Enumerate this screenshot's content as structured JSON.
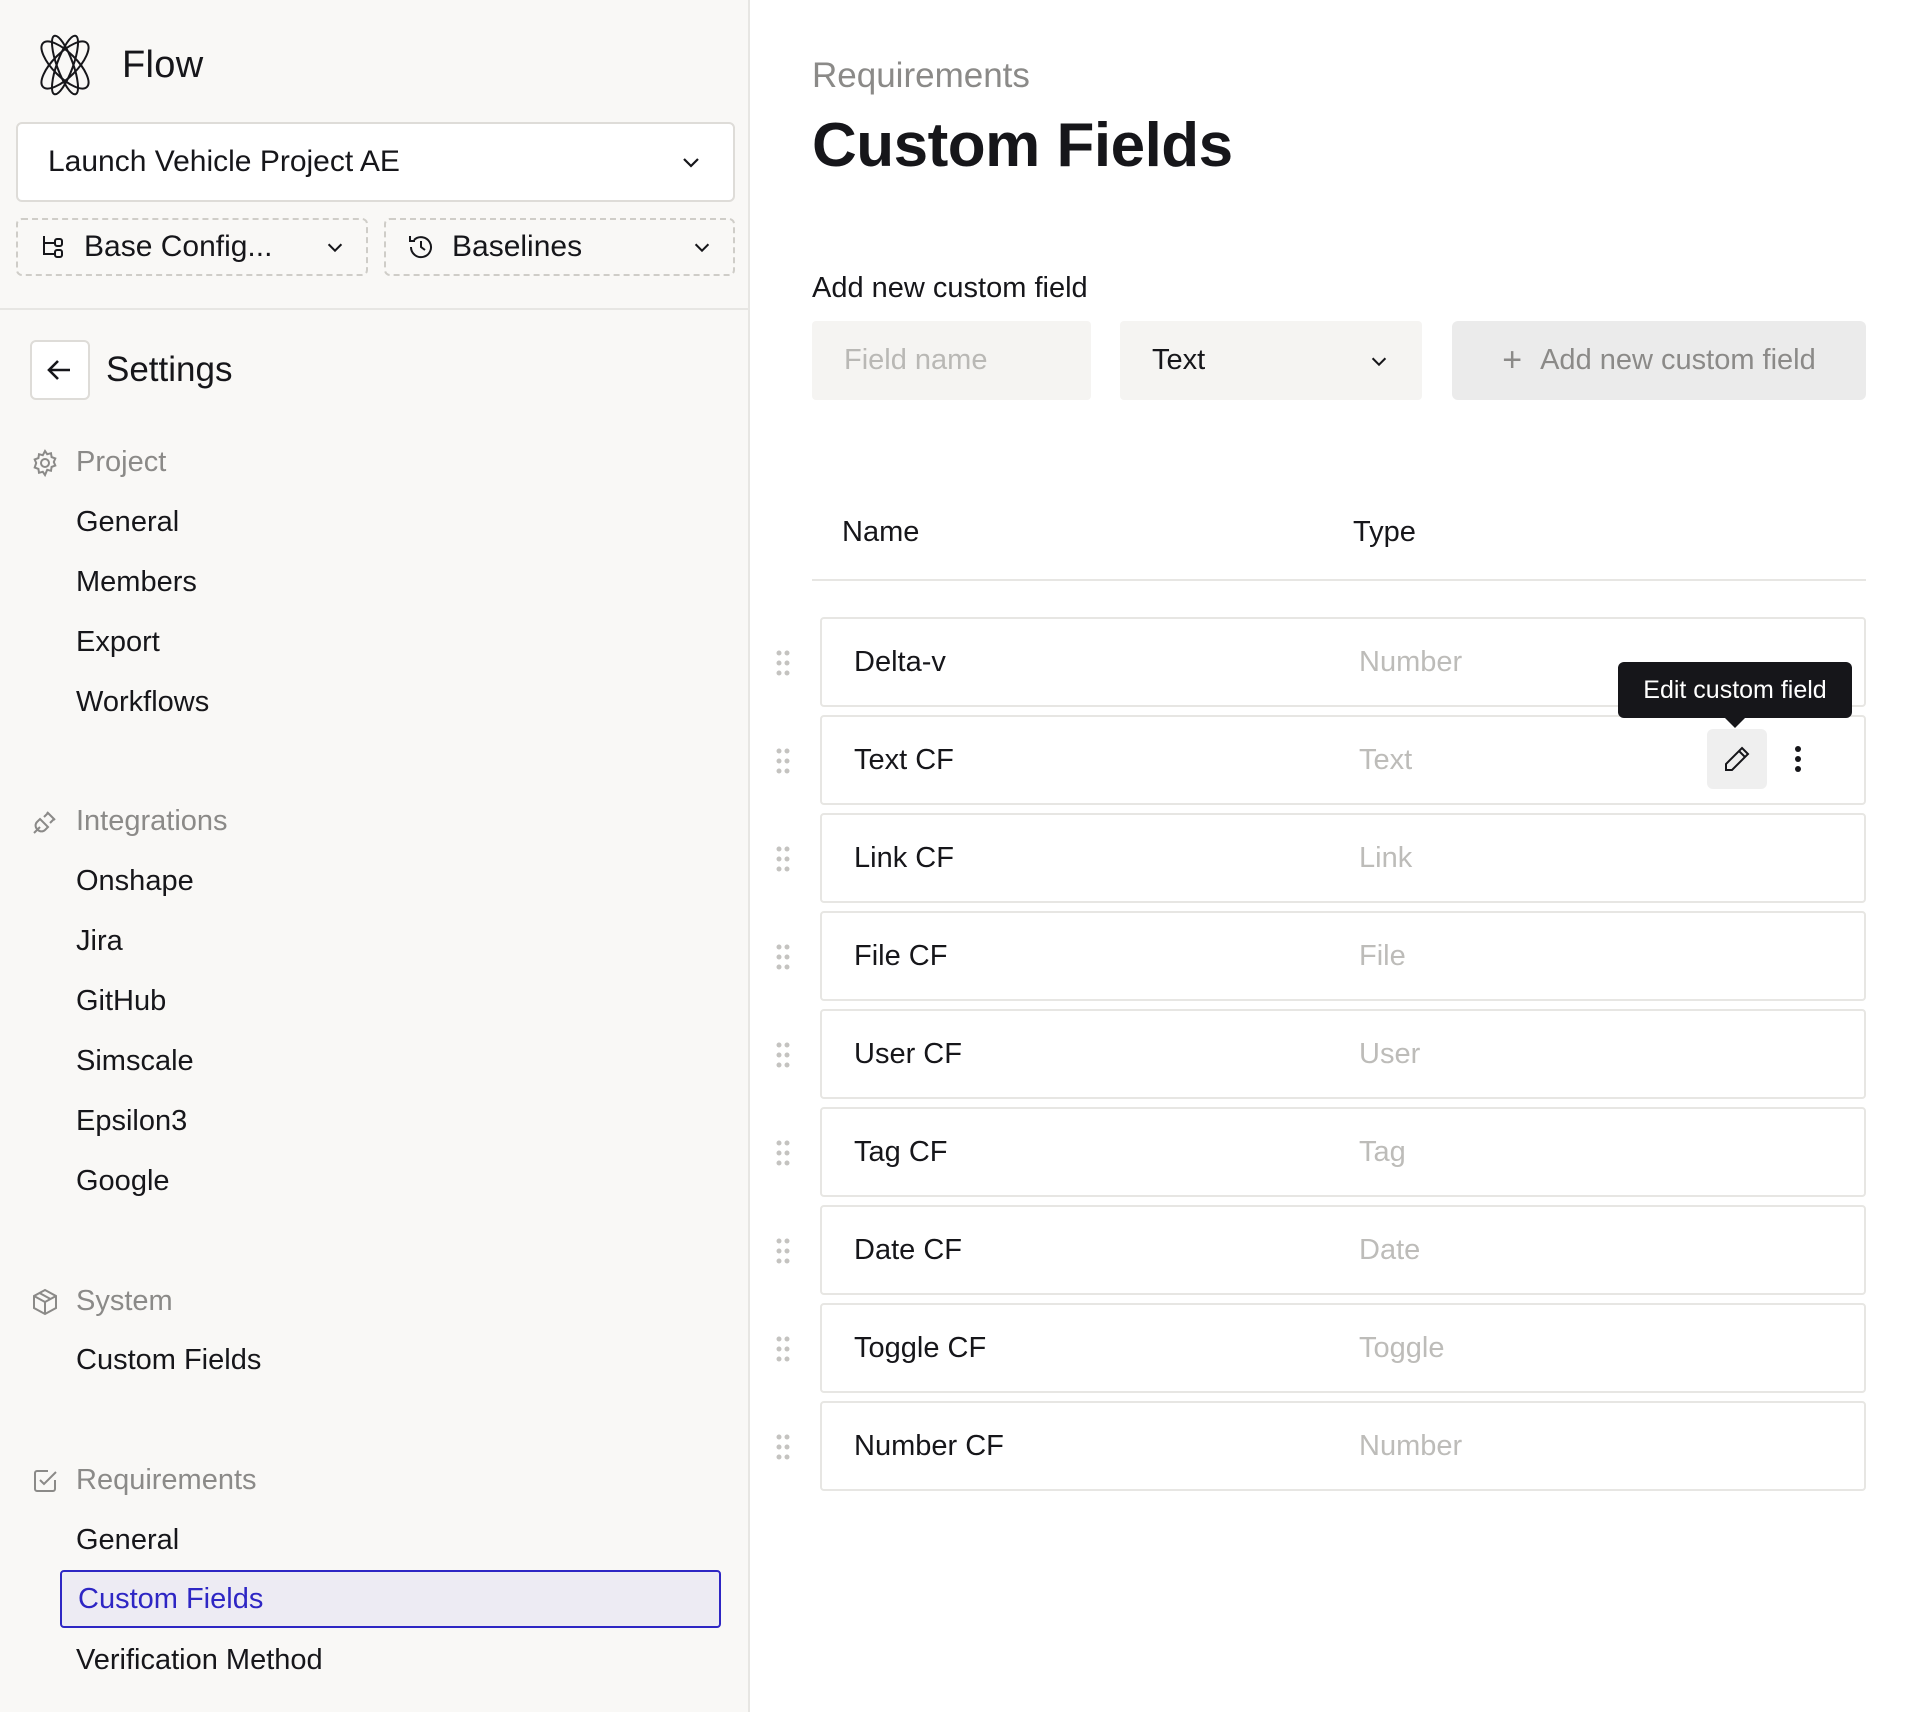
{
  "app": {
    "name": "Flow"
  },
  "project_selector": {
    "value": "Launch Vehicle Project AE"
  },
  "config_selector": {
    "value": "Base Config..."
  },
  "baseline_selector": {
    "value": "Baselines"
  },
  "settings": {
    "title": "Settings"
  },
  "nav": {
    "project": {
      "label": "Project",
      "items": [
        "General",
        "Members",
        "Export",
        "Workflows"
      ]
    },
    "integrations": {
      "label": "Integrations",
      "items": [
        "Onshape",
        "Jira",
        "GitHub",
        "Simscale",
        "Epsilon3",
        "Google"
      ]
    },
    "system": {
      "label": "System",
      "items": [
        "Custom Fields"
      ]
    },
    "requirements": {
      "label": "Requirements",
      "items": [
        "General",
        "Custom Fields",
        "Verification Method"
      ],
      "active": "Custom Fields"
    }
  },
  "main": {
    "breadcrumb": "Requirements",
    "title": "Custom Fields",
    "add_section": {
      "label": "Add new custom field",
      "field_placeholder": "Field name",
      "type_value": "Text",
      "button_label": "Add new custom field"
    },
    "table": {
      "headers": {
        "name": "Name",
        "type": "Type"
      },
      "rows": [
        {
          "name": "Delta-v",
          "type": "Number"
        },
        {
          "name": "Text CF",
          "type": "Text"
        },
        {
          "name": "Link CF",
          "type": "Link"
        },
        {
          "name": "File CF",
          "type": "File"
        },
        {
          "name": "User CF",
          "type": "User"
        },
        {
          "name": "Tag CF",
          "type": "Tag"
        },
        {
          "name": "Date CF",
          "type": "Date"
        },
        {
          "name": "Toggle CF",
          "type": "Toggle"
        },
        {
          "name": "Number CF",
          "type": "Number"
        }
      ]
    },
    "tooltip": "Edit custom field"
  },
  "colors": {
    "accent": "#2e26c4",
    "sidebar_bg": "#f9f8f6",
    "muted_text": "#8b8a88",
    "tooltip_bg": "#16161a"
  }
}
